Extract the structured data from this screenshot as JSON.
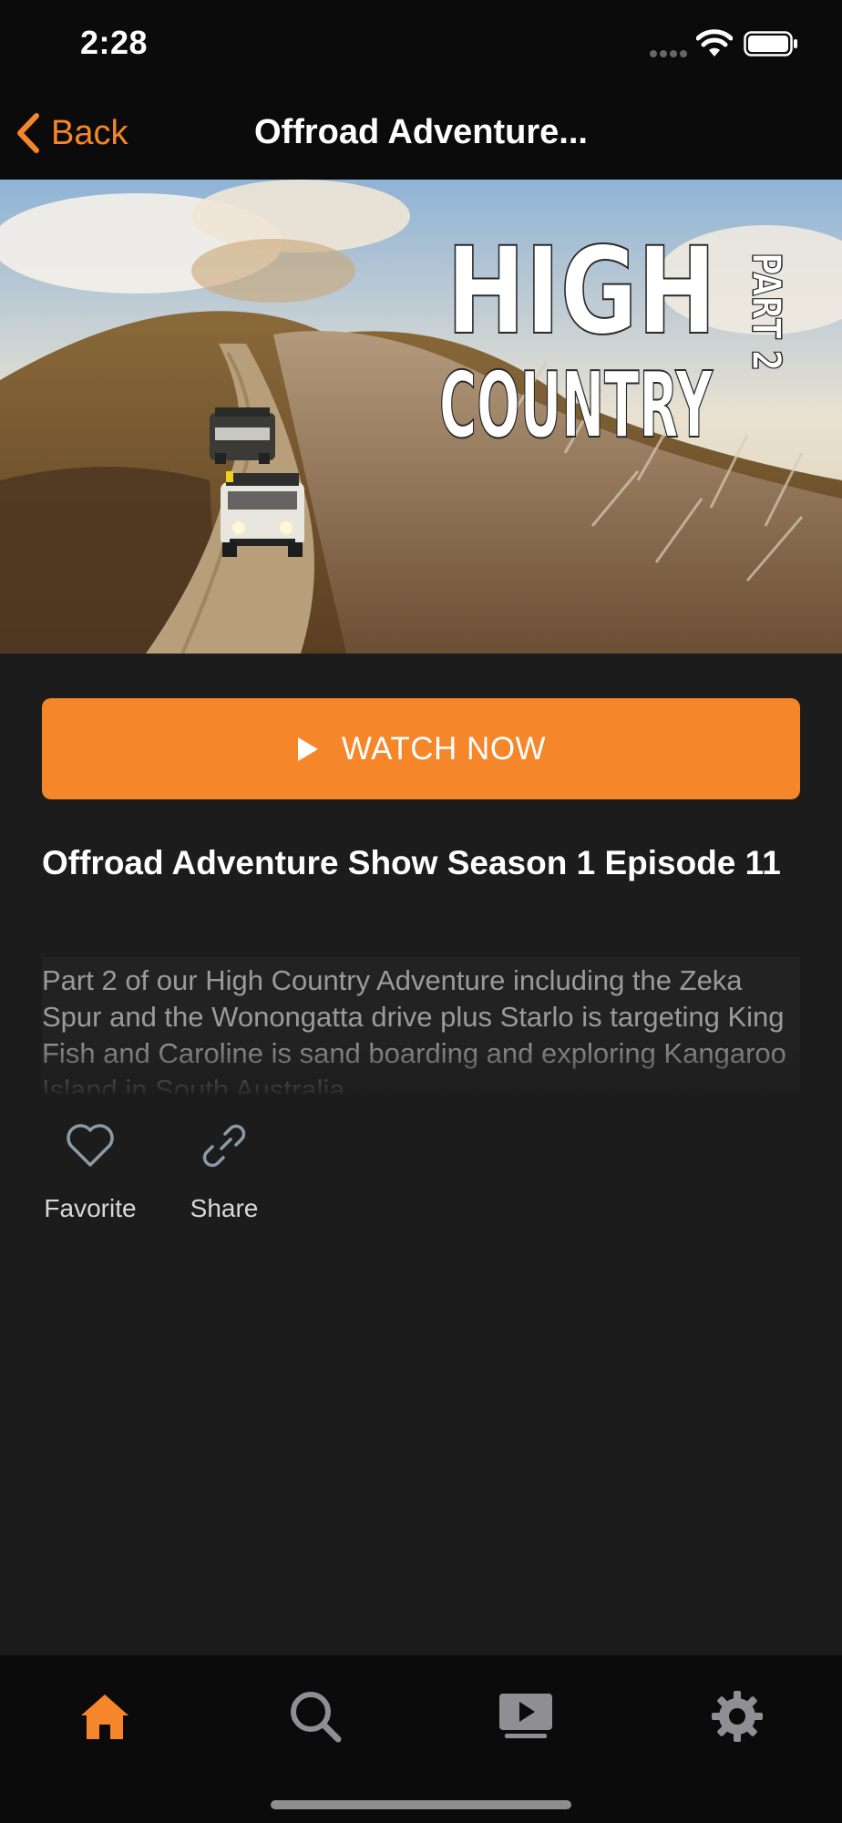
{
  "status_bar": {
    "time": "2:28"
  },
  "nav": {
    "back_label": "Back",
    "title": "Offroad Adventure..."
  },
  "hero": {
    "artwork_text_line1": "HIGH",
    "artwork_text_line2": "COUNTRY",
    "artwork_text_part": "PART 2"
  },
  "watch_button": {
    "label": "WATCH NOW",
    "icon": "play-icon",
    "color": "#f5862a"
  },
  "episode": {
    "title": "Offroad Adventure Show Season 1 Episode 11",
    "description": "Part 2 of our High Country Adventure including the Zeka Spur and the Wonongatta drive plus Starlo is targeting King Fish and Caroline is sand boarding and exploring Kangaroo Island in South Australia."
  },
  "actions": [
    {
      "label": "Favorite",
      "icon": "heart-icon"
    },
    {
      "label": "Share",
      "icon": "link-icon"
    }
  ],
  "tabs": [
    {
      "name": "home",
      "icon": "home-icon",
      "active": true
    },
    {
      "name": "search",
      "icon": "search-icon",
      "active": false
    },
    {
      "name": "videos",
      "icon": "video-library-icon",
      "active": false
    },
    {
      "name": "settings",
      "icon": "gear-icon",
      "active": false
    }
  ],
  "colors": {
    "accent": "#f5862a",
    "background": "#1c1c1c",
    "bars": "#0b0b0b",
    "inactive_icon": "#8e8e93"
  }
}
